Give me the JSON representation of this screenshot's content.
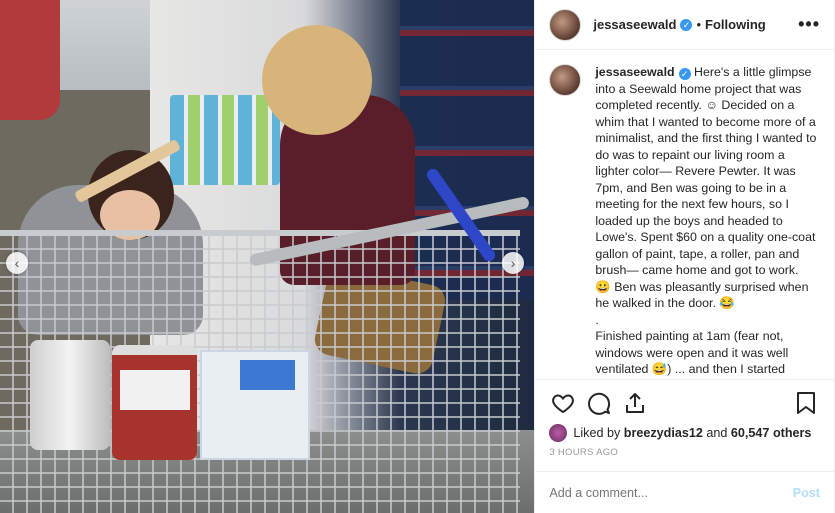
{
  "post": {
    "username": "jessaseewald",
    "verified_glyph": "✓",
    "separator": "•",
    "follow_status": "Following",
    "more_glyph": "•••"
  },
  "caption": {
    "username": "jessaseewald",
    "text": "Here's a little glimpse into a Seewald home project that was completed recently. ☺ Decided on a whim that I wanted to become more of a minimalist, and the first thing I wanted to do was to repaint our living room a lighter color— Revere Pewter. It was 7pm, and Ben was going to be in a meeting for the next few hours, so I loaded up the boys and headed to Lowe's. Spent $60 on a quality one-coat gallon of paint, tape, a roller, pan and brush— came home and got to work. 😀 Ben was pleasantly surprised when he walked in the door. 😂\n.\nFinished painting at 1am (fear not, windows were open and it was well ventilated 😅) ... and then I started"
  },
  "photo": {
    "prev_glyph": "‹",
    "next_glyph": "›"
  },
  "likes": {
    "prefix": "Liked by ",
    "user": "breezydias12",
    "middle": " and ",
    "count": "60,547 others"
  },
  "timestamp": "3 HOURS AGO",
  "comment": {
    "placeholder": "Add a comment...",
    "post_label": "Post"
  },
  "icons": [
    "heart-icon",
    "comment-icon",
    "share-icon",
    "bookmark-icon"
  ]
}
